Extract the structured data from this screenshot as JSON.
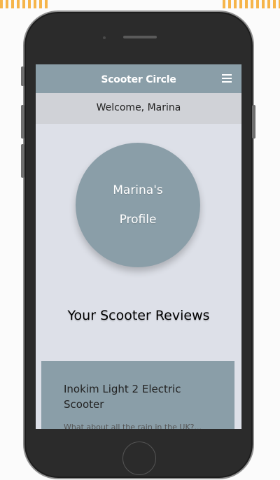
{
  "app": {
    "title": "Scooter Circle",
    "menu_icon": "hamburger-menu-icon",
    "accent_color": "#8a9ea8",
    "background_color": "#dde0e8"
  },
  "welcome": {
    "text": "Welcome, Marina"
  },
  "profile": {
    "line1": "Marina's",
    "line2": "Profile"
  },
  "reviews": {
    "heading": "Your Scooter Reviews",
    "items": [
      {
        "title": "Inokim Light 2 Electric Scooter",
        "snippet": "What about all the rain in the UK?..."
      }
    ]
  }
}
